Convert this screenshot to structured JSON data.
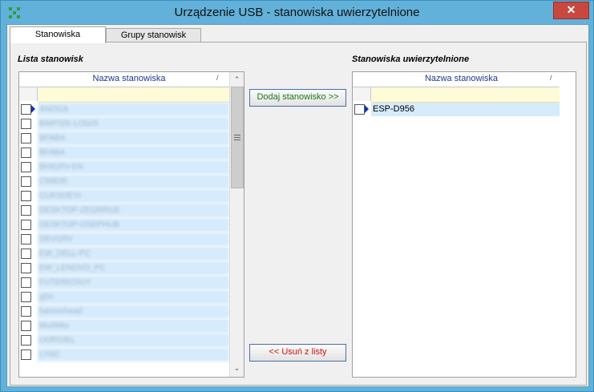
{
  "window": {
    "title": "Urządzenie USB - stanowiska uwierzytelnione",
    "close_glyph": "✕"
  },
  "tabs": [
    {
      "label": "Stanowiska",
      "active": true
    },
    {
      "label": "Grupy stanowisk",
      "active": false
    }
  ],
  "left": {
    "section_label": "Lista stanowisk",
    "column_header": "Nazwa stanowiska",
    "sort_glyph": "/",
    "rows": [
      {
        "name": "ANOGA",
        "current": true
      },
      {
        "name": "BARTEK-LOGIS",
        "current": false
      },
      {
        "name": "BFABA",
        "current": false
      },
      {
        "name": "BFABA",
        "current": false
      },
      {
        "name": "BHIGRV-EN",
        "current": false
      },
      {
        "name": "CIMEIR",
        "current": false
      },
      {
        "name": "CUKSOEYI",
        "current": false
      },
      {
        "name": "DESKTOP-ZEGRRGE",
        "current": false
      },
      {
        "name": "DESKTOP-OSEPHUB",
        "current": false
      },
      {
        "name": "DEVGRV",
        "current": false
      },
      {
        "name": "EW_DELL-PC",
        "current": false
      },
      {
        "name": "EW_LENOVO_PC",
        "current": false
      },
      {
        "name": "FUTERKOIUY",
        "current": false
      },
      {
        "name": "gDn",
        "current": false
      },
      {
        "name": "hannerhead",
        "current": false
      },
      {
        "name": "MuiWAs",
        "current": false
      },
      {
        "name": "LKIRGIEL",
        "current": false
      },
      {
        "name": "LYNC",
        "current": false
      }
    ]
  },
  "buttons": {
    "add": "Dodaj stanowisko >>",
    "remove": "<< Usuń z listy"
  },
  "right": {
    "section_label": "Stanowiska uwierzytelnione",
    "column_header": "Nazwa stanowiska",
    "sort_glyph": "/",
    "rows": [
      {
        "name": "ESP-D956",
        "current": true
      }
    ]
  },
  "colors": {
    "title_bar": "#61b1da",
    "close_button": "#c7483e",
    "row_fill": "#d6ebfb",
    "filter_row": "#fdfbd8",
    "add_text": "#1a7a1a",
    "remove_text": "#d01010"
  },
  "icons": {
    "app": "app-logo-icon",
    "close": "close-icon",
    "scroll_up": "chevron-up-icon",
    "scroll_down": "chevron-down-icon",
    "row_pointer": "row-pointer-icon"
  }
}
